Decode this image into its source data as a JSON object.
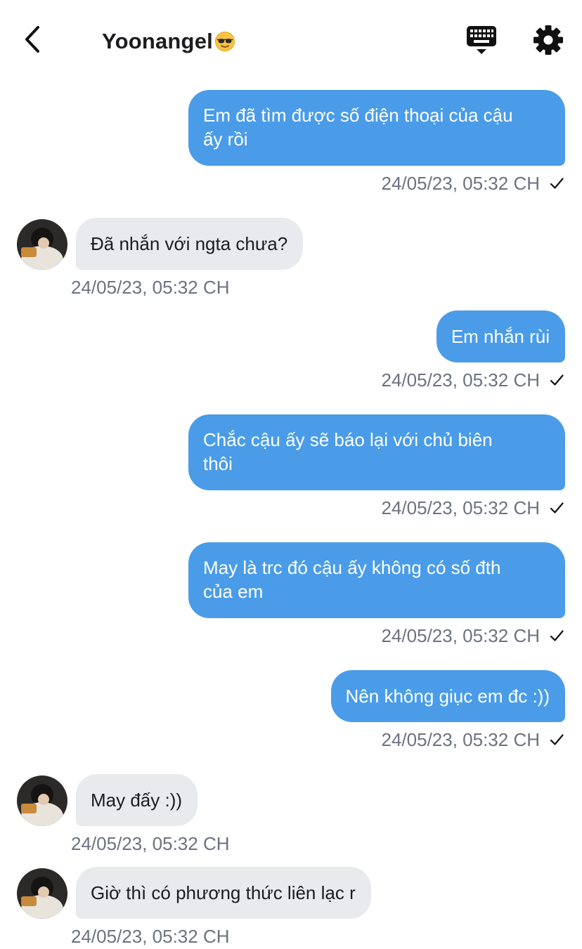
{
  "header": {
    "back_label": "Back",
    "title": "Yoonangel",
    "title_emoji": "sunglasses-emoji",
    "keyboard_icon": "keyboard-icon",
    "settings_icon": "gear-icon"
  },
  "colors": {
    "outgoing_bubble": "#4a9ce8",
    "incoming_bubble": "#e9eaee",
    "timestamp": "#6c7280"
  },
  "messages": [
    {
      "direction": "out",
      "text": "Em đã tìm được số điện thoại của cậu ấy rồi",
      "line1": "Em đã tìm được số điện thoại của cậu",
      "line2": "ấy rồi",
      "time": "24/05/23, 05:32 CH",
      "read": "✓"
    },
    {
      "direction": "in",
      "text": "Đã nhắn với ngta chưa?",
      "time": "24/05/23, 05:32 CH"
    },
    {
      "direction": "out",
      "text": "Em nhắn rùi",
      "time": "24/05/23, 05:32 CH",
      "read": "✓"
    },
    {
      "direction": "out",
      "text": "Chắc cậu ấy sẽ báo lại với chủ biên thôi",
      "line1": "Chắc cậu ấy sẽ báo lại với chủ biên",
      "line2": "thôi",
      "time": "24/05/23, 05:32 CH",
      "read": "✓"
    },
    {
      "direction": "out",
      "text": "May là trc đó cậu ấy không có số đth của em",
      "line1": "May là trc đó cậu ấy không có số đth",
      "line2": "của em",
      "time": "24/05/23, 05:32 CH",
      "read": "✓"
    },
    {
      "direction": "out",
      "text": "Nên không giục em đc :))",
      "time": "24/05/23, 05:32 CH",
      "read": "✓"
    },
    {
      "direction": "in",
      "text": "May đấy :))",
      "time": "24/05/23, 05:32 CH"
    },
    {
      "direction": "in",
      "text": "Giờ thì có phương thức liên lạc r",
      "time": "24/05/23, 05:32 CH"
    }
  ]
}
